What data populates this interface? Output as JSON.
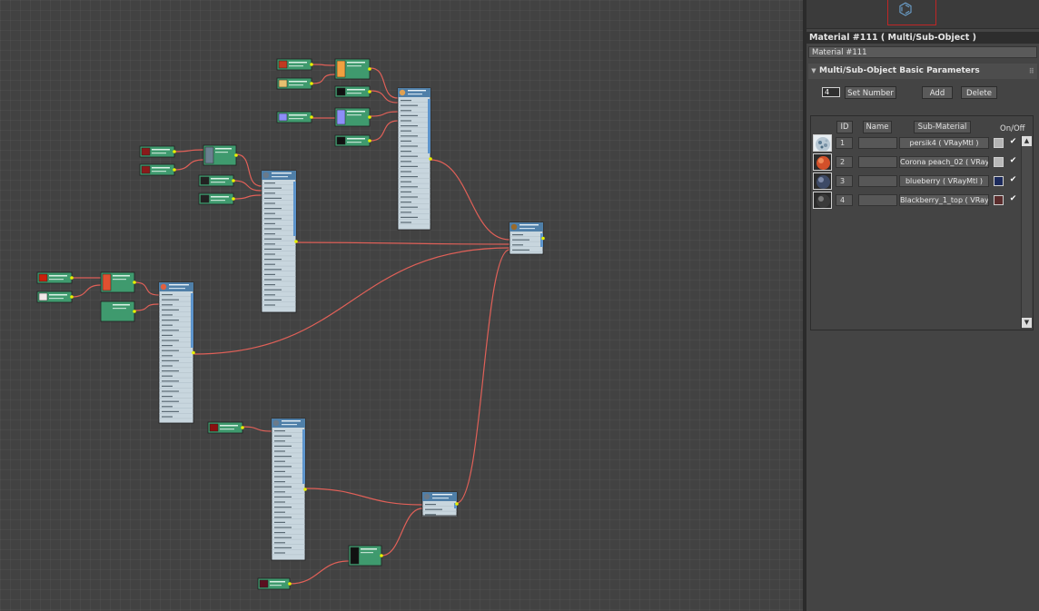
{
  "panel": {
    "header_title": "Material #111  ( Multi/Sub-Object )",
    "material_name": "Material #111",
    "rollout_title": "Multi/Sub-Object Basic Parameters",
    "set_number_value": "4",
    "set_number_label": "Set Number",
    "add_label": "Add",
    "delete_label": "Delete",
    "columns": {
      "id": "ID",
      "name": "Name",
      "submaterial": "Sub-Material",
      "onoff": "On/Off"
    },
    "rows": [
      {
        "id": "1",
        "submaterial": "persik4  ( VRayMtl )",
        "color": "#b4b4b4",
        "checked": "✔",
        "icon": "noise-swatch-icon"
      },
      {
        "id": "2",
        "submaterial": "Corona peach_02  ( VRayM",
        "color": "#b9b9b9",
        "checked": "✔",
        "icon": "peach-swatch-icon"
      },
      {
        "id": "3",
        "submaterial": "blueberry  ( VRayMtl )",
        "color": "#1c2a5c",
        "checked": "✔",
        "icon": "blueberry-swatch-icon"
      },
      {
        "id": "4",
        "submaterial": "Blackberry_1_top  ( VRay2",
        "color": "#5a2c2c",
        "checked": "✔",
        "icon": "blackberry-swatch-icon"
      }
    ]
  },
  "colors": {
    "graph_bg": "#424242",
    "wire": "#e06058",
    "map_node_header": "#3f9a6e",
    "map_node_body": "#c8d6de",
    "material_node_header": "#4f7fa8",
    "material_node_body": "#c8d6de",
    "socket": "#e6f000"
  }
}
